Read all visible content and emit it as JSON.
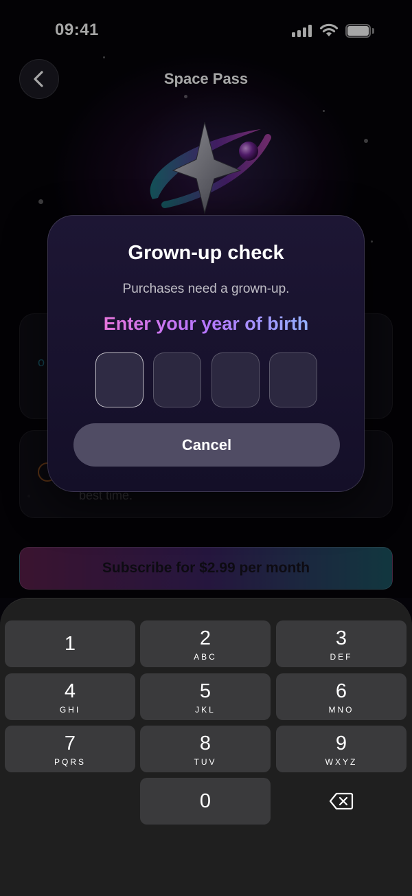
{
  "status_bar": {
    "time": "09:41"
  },
  "header": {
    "title": "Space Pass"
  },
  "background": {
    "card2_text": "best time.",
    "subscribe_label": "Subscribe for $2.99 per month"
  },
  "modal": {
    "title": "Grown-up check",
    "subtitle": "Purchases need a grown-up.",
    "prompt": "Enter your year of birth",
    "digits": [
      "",
      "",
      "",
      ""
    ],
    "cancel_label": "Cancel"
  },
  "keypad": {
    "keys": [
      {
        "num": "1",
        "letters": ""
      },
      {
        "num": "2",
        "letters": "ABC"
      },
      {
        "num": "3",
        "letters": "DEF"
      },
      {
        "num": "4",
        "letters": "GHI"
      },
      {
        "num": "5",
        "letters": "JKL"
      },
      {
        "num": "6",
        "letters": "MNO"
      },
      {
        "num": "7",
        "letters": "PQRS"
      },
      {
        "num": "8",
        "letters": "TUV"
      },
      {
        "num": "9",
        "letters": "WXYZ"
      },
      {
        "num": "0",
        "letters": ""
      }
    ],
    "backspace_icon": "backspace-icon"
  },
  "colors": {
    "prompt_gradient": [
      "#ff74c8",
      "#b676ff",
      "#7fd0ff"
    ],
    "modal_bg": "#1d1634",
    "cancel_bg": "#504c64",
    "key_bg": "#3a3a3c"
  }
}
